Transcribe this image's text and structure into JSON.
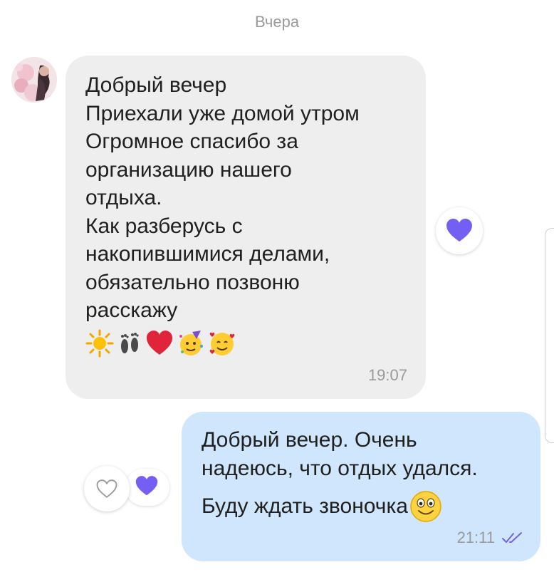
{
  "date_separator": "Вчера",
  "incoming": {
    "text": "Добрый вечер\nПриехали уже домой утром\nОгромное спасибо за\nорганизацию нашего\nотдыха.\nКак разберусь с\nнакопившимися делами,\nобязательно позвоню\nрасскажу",
    "emojis": [
      "sun-emoji",
      "footprints-emoji",
      "red-heart-emoji",
      "partying-face-emoji",
      "smiling-face-with-hearts-emoji"
    ],
    "time": "19:07",
    "reaction": "purple-heart-icon"
  },
  "outgoing": {
    "line1": "Добрый вечер. Очень\nнадеюсь, что отдых удался.",
    "line2": "Буду ждать звоночка",
    "emoji": "smiling-face-emoji",
    "time": "21:11",
    "status": "double-check-icon"
  },
  "like_controls": {
    "outline_icon": "heart-outline-icon",
    "filled_icon": "purple-heart-icon"
  },
  "colors": {
    "incoming_bubble": "#eeeeee",
    "outgoing_bubble": "#cfe6fd",
    "accent_purple": "#7360f2",
    "meta_text": "#9a9a9a"
  }
}
